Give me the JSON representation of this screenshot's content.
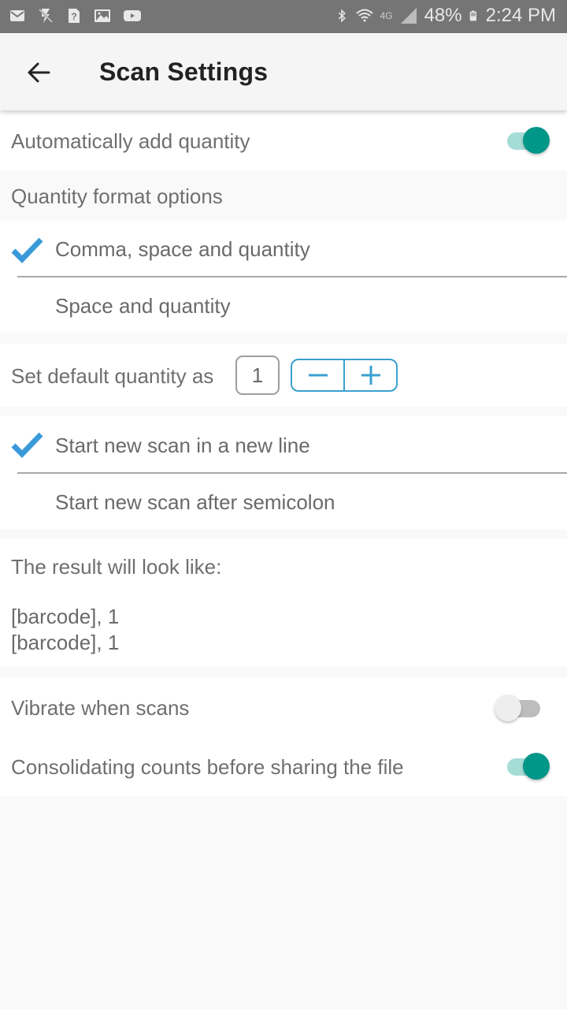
{
  "status_bar": {
    "left_icons": [
      "mail-icon",
      "flash-off-icon",
      "unknown-file-icon",
      "image-icon",
      "youtube-icon"
    ],
    "right_icons": [
      "bluetooth-icon",
      "wifi-icon",
      "4g-lte-icon",
      "signal-icon"
    ],
    "network_label": "4G",
    "battery": "48%",
    "time": "2:24 PM"
  },
  "app_bar": {
    "title": "Scan Settings",
    "back_icon": "arrow-left-icon"
  },
  "settings": {
    "auto_add_quantity": {
      "label": "Automatically add quantity",
      "enabled": true
    },
    "quantity_format": {
      "header": "Quantity format options",
      "options": [
        {
          "label": "Comma, space and quantity",
          "selected": true
        },
        {
          "label": "Space and quantity",
          "selected": false
        }
      ]
    },
    "default_quantity": {
      "label": "Set default quantity as",
      "value": "1",
      "decrement_label": "−",
      "increment_label": "+"
    },
    "scan_separator": {
      "options": [
        {
          "label": "Start new scan in a new line",
          "selected": true
        },
        {
          "label": "Start new scan after semicolon",
          "selected": false
        }
      ]
    },
    "preview": {
      "label": "The result will look like:",
      "lines": [
        "[barcode], 1",
        "[barcode], 1"
      ]
    },
    "vibrate": {
      "label": "Vibrate when scans",
      "enabled": false
    },
    "consolidate": {
      "label": "Consolidating counts before sharing the file",
      "enabled": true
    }
  },
  "colors": {
    "accent": "#009688",
    "accent_track": "#a6dcd6",
    "check": "#3a9ad9",
    "stepper_border": "#3aa0cf",
    "status_bar": "#757575"
  }
}
